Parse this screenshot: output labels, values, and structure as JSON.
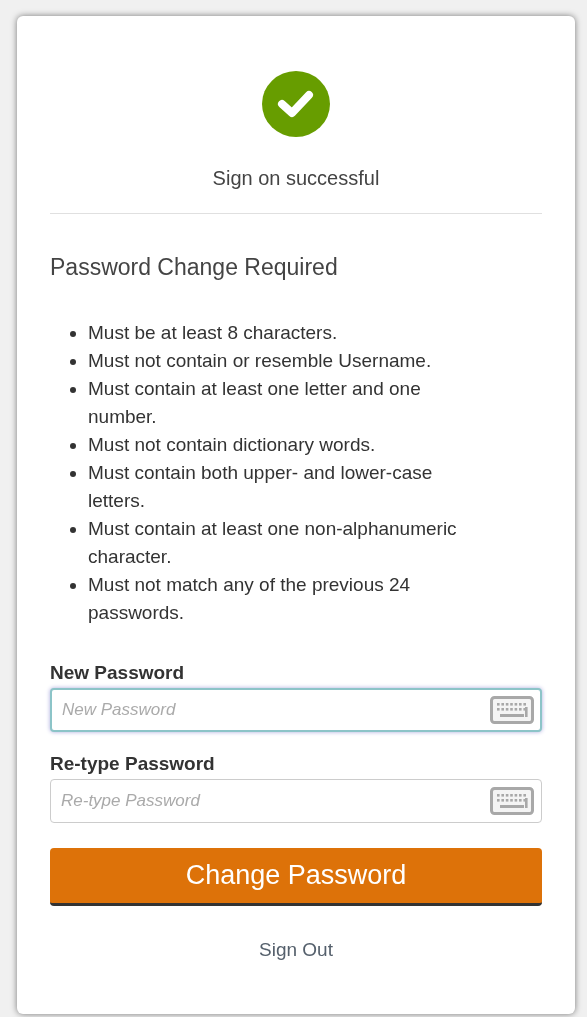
{
  "status": {
    "message": "Sign on successful"
  },
  "heading": "Password Change Required",
  "rules": [
    "Must be at least 8 characters.",
    "Must not contain or resemble Username.",
    "Must contain at least one letter and one number.",
    "Must not contain dictionary words.",
    "Must contain both upper- and lower-case letters.",
    "Must contain at least one non-alphanumeric character.",
    "Must not match any of the previous 24 passwords."
  ],
  "fields": [
    {
      "label": "New Password",
      "placeholder": "New Password",
      "focused": true
    },
    {
      "label": "Re-type Password",
      "placeholder": "Re-type Password",
      "focused": false
    }
  ],
  "submit_button": "Change Password",
  "sign_out_link": "Sign Out"
}
